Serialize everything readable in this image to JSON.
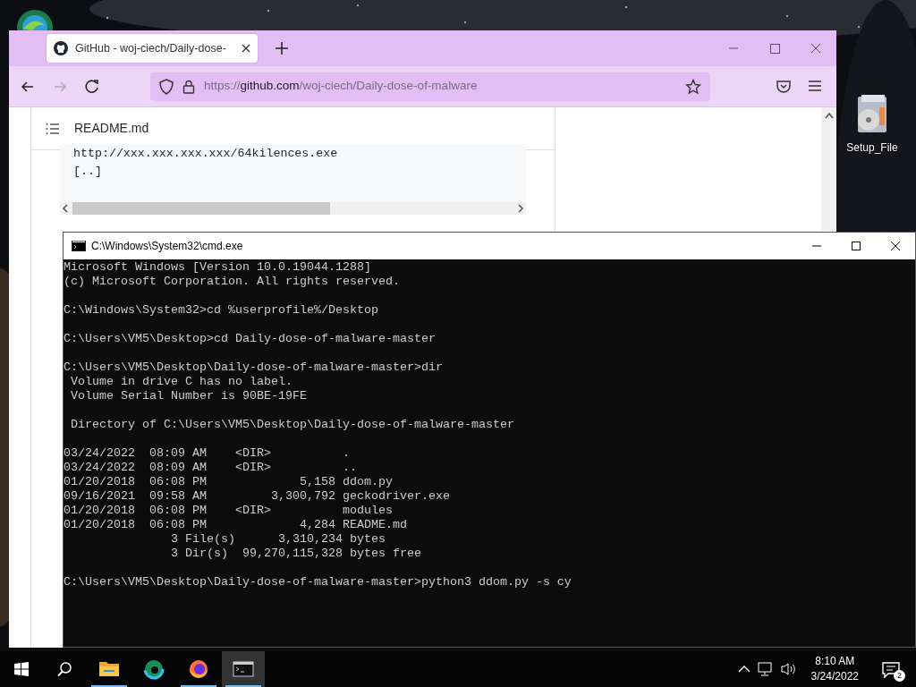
{
  "desktop": {
    "icons": [
      {
        "label": "Setup_File"
      }
    ]
  },
  "browser": {
    "tabs": [
      {
        "title": "GitHub - woj-ciech/Daily-dose-",
        "selected": true
      }
    ],
    "address": {
      "scheme": "https://",
      "host": "github.com",
      "path": "/woj-ciech/Daily-dose-of-malware"
    },
    "readme": {
      "title": "README.md",
      "code_lines": [
        "http://xxx.xxx.xxx.xxx/64kilences.exe",
        "[..]"
      ]
    }
  },
  "cmd": {
    "title": "C:\\Windows\\System32\\cmd.exe",
    "blocks": [
      [
        "Microsoft Windows [Version 10.0.19044.1288]",
        "(c) Microsoft Corporation. All rights reserved."
      ],
      [
        "C:\\Windows\\System32>cd %userprofile%/Desktop"
      ],
      [
        "C:\\Users\\VM5\\Desktop>cd Daily-dose-of-malware-master"
      ],
      [
        "C:\\Users\\VM5\\Desktop\\Daily-dose-of-malware-master>dir",
        " Volume in drive C has no label.",
        " Volume Serial Number is 90BE-19FE"
      ],
      [
        " Directory of C:\\Users\\VM5\\Desktop\\Daily-dose-of-malware-master"
      ],
      [
        "03/24/2022  08:09 AM    <DIR>          .",
        "03/24/2022  08:09 AM    <DIR>          ..",
        "01/20/2018  06:08 PM             5,158 ddom.py",
        "09/16/2021  09:58 AM         3,300,792 geckodriver.exe",
        "01/20/2018  06:08 PM    <DIR>          modules",
        "01/20/2018  06:08 PM             4,284 README.md",
        "               3 File(s)      3,310,234 bytes",
        "               3 Dir(s)  99,270,115,328 bytes free"
      ],
      [
        "C:\\Users\\VM5\\Desktop\\Daily-dose-of-malware-master>python3 ddom.py -s cy"
      ]
    ]
  },
  "taskbar": {
    "apps": [
      {
        "kind": "folder",
        "running": true,
        "selected": false
      },
      {
        "kind": "edge",
        "running": false,
        "selected": false
      },
      {
        "kind": "firefox",
        "running": true,
        "selected": false
      },
      {
        "kind": "terminal",
        "running": true,
        "selected": true
      }
    ],
    "time": "8:10 AM",
    "date": "3/24/2022",
    "notifications": "2"
  }
}
